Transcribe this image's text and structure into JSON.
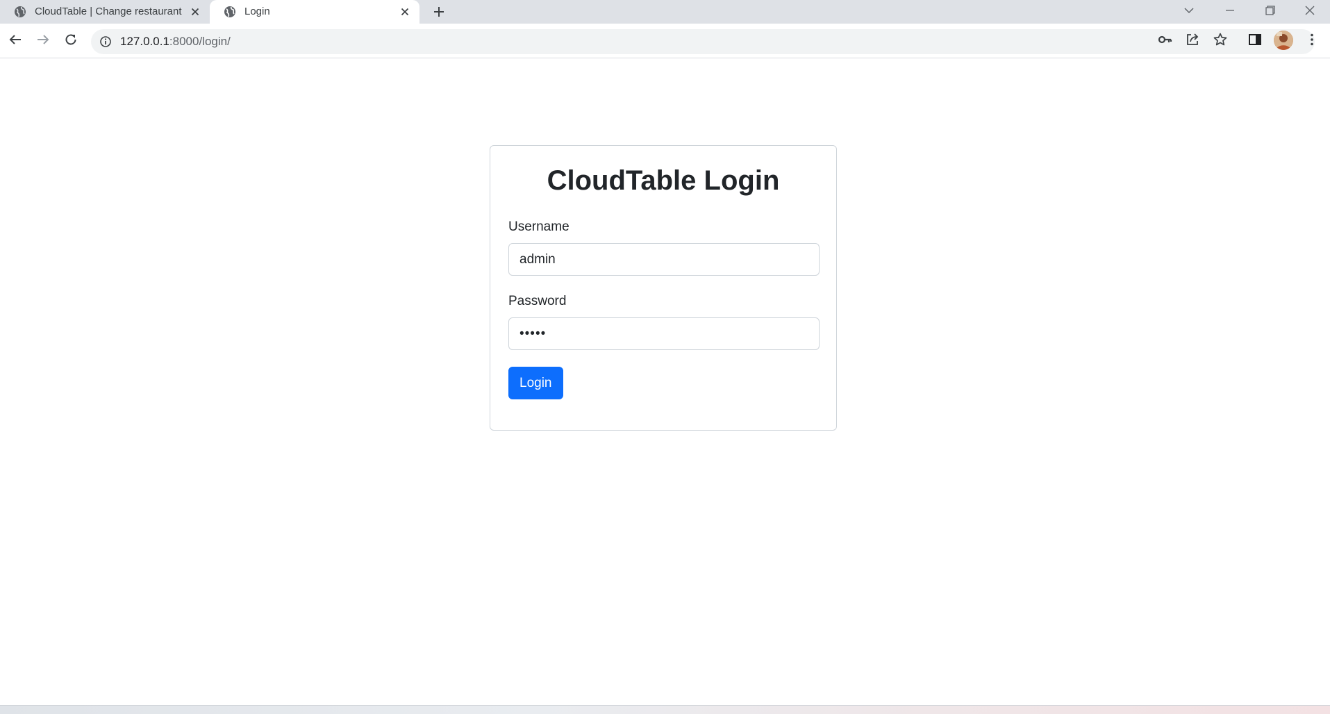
{
  "browser": {
    "tabs": [
      {
        "title": "CloudTable | Change restaurant |",
        "active": false
      },
      {
        "title": "Login",
        "active": true
      }
    ],
    "url_host": "127.0.0.1",
    "url_path": ":8000/login/",
    "icons": {
      "tab_favicon": "globe-icon",
      "back": "arrow-left-icon",
      "forward": "arrow-right-icon",
      "reload": "reload-icon",
      "site_info": "info-icon",
      "password": "key-icon",
      "share": "share-icon",
      "bookmark": "star-icon",
      "side_panel": "side-panel-icon",
      "menu": "kebab-menu-icon"
    }
  },
  "login": {
    "title": "CloudTable Login",
    "username_label": "Username",
    "username_value": "admin",
    "password_label": "Password",
    "password_value": "•••••",
    "submit_label": "Login"
  },
  "colors": {
    "primary": "#0d6efd",
    "text": "#212529",
    "border": "#ced4da",
    "tabstrip": "#dee1e6"
  }
}
